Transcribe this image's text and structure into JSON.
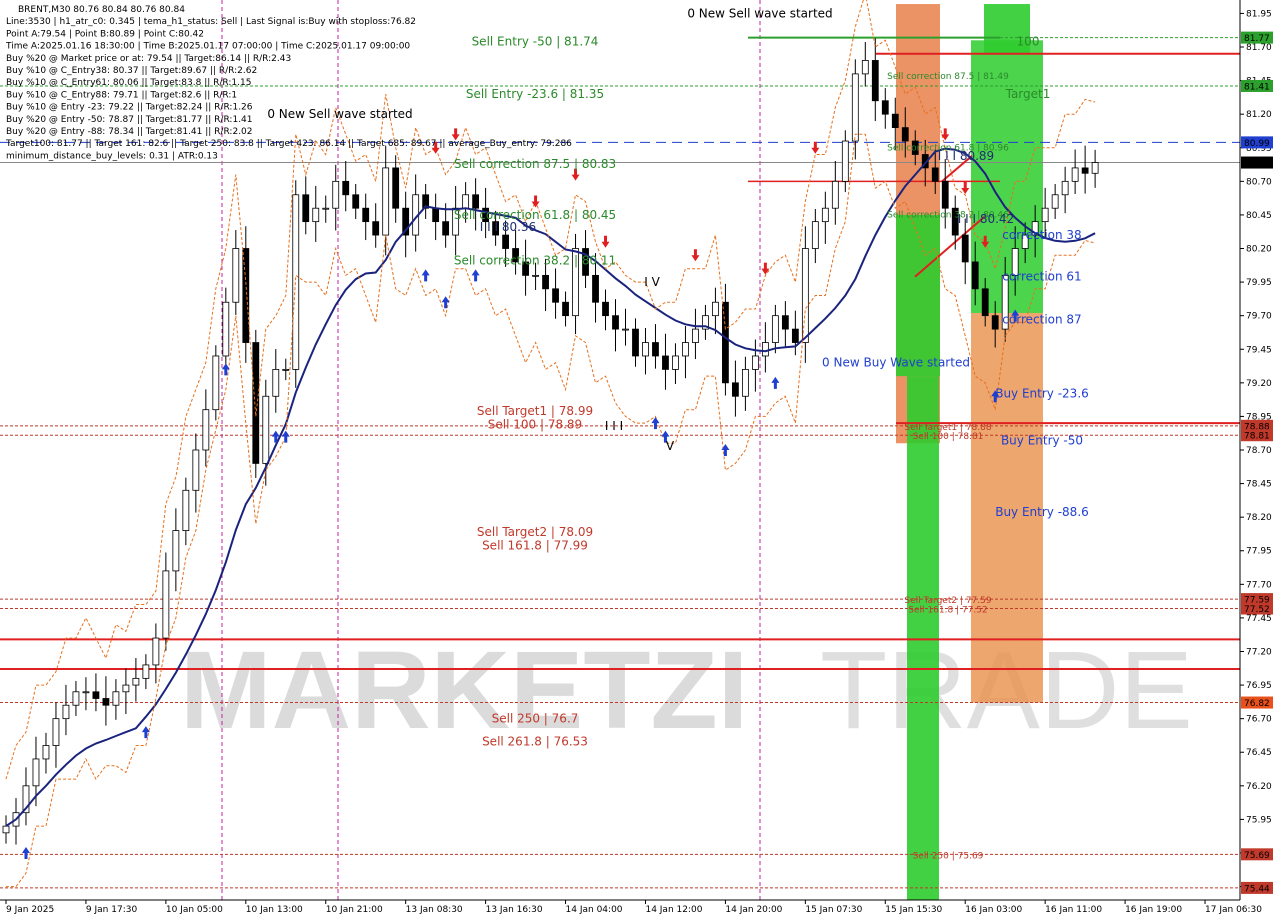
{
  "header_lines": [
    "BRENT,M30  80.76 80.84 80.76 80.84",
    "Line:3530 | h1_atr_c0: 0.345 | tema_h1_status: Sell | Last Signal is:Buy with stoploss:76.82",
    "Point A:79.54 | Point B:80.89 | Point C:80.42",
    "Time A:2025.01.16 18:30:00 | Time B:2025.01.17 07:00:00 | Time C:2025.01.17 09:00:00",
    "Buy %20 @ Market price or at: 79.54 || Target:86.14 || R/R:2.43",
    "Buy %10 @ C_Entry38: 80.37 || Target:89.67 || R/R:2.62",
    "Buy %10 @ C_Entry61: 80.06 || Target:83.8 || R/R:1.15",
    "Buy %10 @ C_Entry88: 79.71 || Target:82.6 || R/R:1",
    "Buy %10 @ Entry -23: 79.22 || Target:82.24 || R/R:1.26",
    "Buy %20 @ Entry -50: 78.87 || Target:81.77 || R/R:1.41",
    "Buy %20 @ Entry -88: 78.34 || Target:81.41 || R/R:2.02",
    "Target100: 81.77 || Target 161: 82.6 || Target 250: 83.8 || Target 423: 86.14 || Target 685: 89.67 || average_Buy_entry: 79.286",
    "minimum_distance_buy_levels: 0.31 | ATR:0.13"
  ],
  "watermark": {
    "line1": "MARKETZI",
    "line2": "TRADE"
  },
  "chart_data": {
    "type": "candlestick",
    "symbol": "BRENT",
    "timeframe": "M30",
    "y_axis": {
      "min": 75.35,
      "max": 82.05,
      "ticks": [
        "81.95",
        "81.70",
        "81.45",
        "81.20",
        "80.95",
        "80.70",
        "80.45",
        "80.20",
        "79.95",
        "79.70",
        "79.45",
        "79.20",
        "78.95",
        "78.70",
        "78.45",
        "78.20",
        "77.95",
        "77.70",
        "77.45",
        "77.20",
        "76.95",
        "76.70",
        "76.45",
        "76.20",
        "75.95",
        "75.70",
        "75.45"
      ],
      "tick_values": [
        81.95,
        81.7,
        81.45,
        81.2,
        80.95,
        80.7,
        80.45,
        80.2,
        79.95,
        79.7,
        79.45,
        79.2,
        78.95,
        78.7,
        78.45,
        78.2,
        77.95,
        77.7,
        77.45,
        77.2,
        76.95,
        76.7,
        76.45,
        76.2,
        75.95,
        75.7,
        75.45
      ]
    },
    "x_axis": {
      "labels": [
        "9 Jan 2025",
        "9 Jan 17:30",
        "10 Jan 05:00",
        "10 Jan 13:00",
        "10 Jan 21:00",
        "13 Jan 08:30",
        "13 Jan 16:30",
        "14 Jan 04:00",
        "14 Jan 12:00",
        "14 Jan 20:00",
        "15 Jan 07:30",
        "15 Jan 15:30",
        "16 Jan 03:00",
        "16 Jan 11:00",
        "16 Jan 19:00",
        "17 Jan 06:30"
      ],
      "label_index": [
        0,
        8,
        16,
        24,
        32,
        40,
        48,
        56,
        64,
        72,
        80,
        88,
        96,
        104,
        112,
        120
      ],
      "count": 124
    },
    "price_badges": [
      {
        "text": "81.77",
        "value": 81.77,
        "color": "#2ca02c"
      },
      {
        "text": "81.41",
        "value": 81.41,
        "color": "#2ca02c"
      },
      {
        "text": "80.99",
        "value": 80.99,
        "color": "#1f3fd0"
      },
      {
        "text": "80.84",
        "value": 80.84,
        "color": "#000000"
      },
      {
        "text": "78.88",
        "value": 78.88,
        "color": "#c0392b"
      },
      {
        "text": "78.81",
        "value": 78.81,
        "color": "#c0392b"
      },
      {
        "text": "77.59",
        "value": 77.59,
        "color": "#c0392b"
      },
      {
        "text": "77.52",
        "value": 77.52,
        "color": "#c0392b"
      },
      {
        "text": "76.82",
        "value": 76.82,
        "color": "#e8501c"
      },
      {
        "text": "75.69",
        "value": 75.69,
        "color": "#c0392b"
      },
      {
        "text": "75.44",
        "value": 75.44,
        "color": "#c0392b"
      }
    ],
    "close_series": [
      75.9,
      76.0,
      76.2,
      76.4,
      76.5,
      76.7,
      76.8,
      76.9,
      76.9,
      76.85,
      76.8,
      76.9,
      76.95,
      77.0,
      77.1,
      77.3,
      77.8,
      78.1,
      78.4,
      78.7,
      79.0,
      79.4,
      79.8,
      80.2,
      79.5,
      78.6,
      79.1,
      79.3,
      79.3,
      80.6,
      80.4,
      80.5,
      80.5,
      80.7,
      80.6,
      80.5,
      80.4,
      80.3,
      80.8,
      80.5,
      80.3,
      80.6,
      80.5,
      80.4,
      80.3,
      80.5,
      80.6,
      80.5,
      80.4,
      80.3,
      80.2,
      80.1,
      80.0,
      80.0,
      79.9,
      79.8,
      79.7,
      80.2,
      80.0,
      79.8,
      79.7,
      79.6,
      79.6,
      79.4,
      79.5,
      79.4,
      79.3,
      79.4,
      79.5,
      79.6,
      79.7,
      79.8,
      79.2,
      79.1,
      79.3,
      79.4,
      79.5,
      79.7,
      79.6,
      79.5,
      80.2,
      80.4,
      80.5,
      80.7,
      81.0,
      81.5,
      81.6,
      81.3,
      81.2,
      81.1,
      81.0,
      80.9,
      80.8,
      80.7,
      80.5,
      80.3,
      80.1,
      79.9,
      79.7,
      79.6,
      80.0,
      80.2,
      80.3,
      80.4,
      80.5,
      80.6,
      80.7,
      80.8,
      80.76,
      80.84
    ],
    "levels": [
      {
        "text": "Sell Entry -50 | 81.74",
        "value": 81.74,
        "color": "#2a8a2a",
        "style": "dashed",
        "label_x": "mid"
      },
      {
        "text": "Sell Entry -23.6 | 81.35",
        "value": 81.35,
        "color": "#2a8a2a",
        "style": "none",
        "label_x": "mid"
      },
      {
        "text": "Sell correction 87.5 | 80.83",
        "value": 80.83,
        "color": "#2a8a2a",
        "style": "none",
        "label_x": "mid"
      },
      {
        "text": "Sell correction 61.8 | 80.45",
        "value": 80.45,
        "color": "#2a8a2a",
        "style": "none",
        "label_x": "mid"
      },
      {
        "text": "Sell correction 38.2 | 80.11",
        "value": 80.11,
        "color": "#2a8a2a",
        "style": "none",
        "label_x": "mid"
      },
      {
        "text": "Sell Target1 | 78.99",
        "value": 78.99,
        "color": "#c0392b",
        "style": "none",
        "label_x": "mid"
      },
      {
        "text": "Sell 100 | 78.89",
        "value": 78.89,
        "color": "#c0392b",
        "style": "none",
        "label_x": "mid"
      },
      {
        "text": "Sell Target2 | 78.09",
        "value": 78.09,
        "color": "#c0392b",
        "style": "none",
        "label_x": "mid"
      },
      {
        "text": "Sell 161.8 | 77.99",
        "value": 77.99,
        "color": "#c0392b",
        "style": "none",
        "label_x": "mid"
      },
      {
        "text": "Sell  250 | 76.7",
        "value": 76.7,
        "color": "#c0392b",
        "style": "none",
        "label_x": "mid"
      },
      {
        "text": "Sell  261.8 | 76.53",
        "value": 76.53,
        "color": "#c0392b",
        "style": "none",
        "label_x": "mid"
      },
      {
        "text": "Sell correction 87.5 | 81.49",
        "value": 81.49,
        "color": "#2a8a2a",
        "style": "none",
        "label_x": "right"
      },
      {
        "text": "Sell correction 61.8 | 80.96",
        "value": 80.96,
        "color": "#2a8a2a",
        "style": "none",
        "label_x": "right"
      },
      {
        "text": "Sell correction 38.2 | 80.46",
        "value": 80.46,
        "color": "#2a8a2a",
        "style": "none",
        "label_x": "right"
      },
      {
        "text": "Sell Target1 | 78.88",
        "value": 78.88,
        "color": "#c0392b",
        "style": "none",
        "label_x": "right"
      },
      {
        "text": "Sell 100 | 78.81",
        "value": 78.81,
        "color": "#c0392b",
        "style": "none",
        "label_x": "right"
      },
      {
        "text": "Sell Target2 | 77.59",
        "value": 77.59,
        "color": "#c0392b",
        "style": "none",
        "label_x": "right"
      },
      {
        "text": "Sell 161.8 | 77.52",
        "value": 77.52,
        "color": "#c0392b",
        "style": "none",
        "label_x": "right"
      },
      {
        "text": "Sell  250 | 75.69",
        "value": 75.69,
        "color": "#c0392b",
        "style": "none",
        "label_x": "right"
      }
    ],
    "annotations": [
      {
        "text": "0 New Sell wave started",
        "value": 81.95,
        "color": "#000000",
        "pos": "top-mid"
      },
      {
        "text": "0 New Sell wave started",
        "value": 81.2,
        "color": "#000000",
        "pos": "left-mid"
      },
      {
        "text": "0 New Buy Wave started",
        "value": 79.35,
        "color": "#1f3fd0",
        "pos": "right"
      },
      {
        "text": "I I I 80.36",
        "value": 80.36,
        "color": "#1f2f6f",
        "pos": "mid"
      },
      {
        "text": "I I I 80.89",
        "value": 80.89,
        "color": "#1f2f6f",
        "pos": "right"
      },
      {
        "text": "I I I 80.42",
        "value": 80.42,
        "color": "#1f2f6f",
        "pos": "right"
      },
      {
        "text": "Target1",
        "value": 81.35,
        "color": "#2a8a2a",
        "pos": "right"
      },
      {
        "text": "100",
        "value": 81.74,
        "color": "#2a8a2a",
        "pos": "right"
      },
      {
        "text": "correction 38",
        "value": 80.3,
        "color": "#1f3fd0",
        "pos": "right"
      },
      {
        "text": "correction 61",
        "value": 79.99,
        "color": "#1f3fd0",
        "pos": "right"
      },
      {
        "text": "correction 87",
        "value": 79.67,
        "color": "#1f3fd0",
        "pos": "right"
      },
      {
        "text": "Buy Entry -23.6",
        "value": 79.12,
        "color": "#1f3fd0",
        "pos": "right"
      },
      {
        "text": "Buy Entry -50",
        "value": 78.77,
        "color": "#1f3fd0",
        "pos": "right"
      },
      {
        "text": "Buy Entry -88.6",
        "value": 78.24,
        "color": "#1f3fd0",
        "pos": "right"
      },
      {
        "text": "I V",
        "value": 79.95,
        "color": "#000000",
        "pos": "mid"
      },
      {
        "text": "I I I",
        "value": 78.88,
        "color": "#000000",
        "pos": "mid"
      },
      {
        "text": "V",
        "value": 78.73,
        "color": "#000000",
        "pos": "mid"
      }
    ]
  }
}
